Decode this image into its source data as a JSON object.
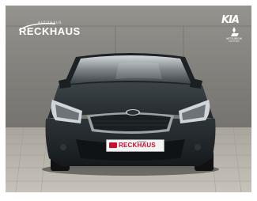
{
  "photo": {
    "subject": "kia-ceed-front-view",
    "colors": {
      "wall": "#8d8b86",
      "wall_dark": "#6f6d68",
      "floor": "#b7b2aa",
      "car_body": "#2a3136",
      "car_dark": "#14181b",
      "grille_chrome": "#9aa3a8",
      "sky_reflection": "#c9ced0"
    }
  },
  "dealer_logo": {
    "prefix": "AUTOHAUS",
    "name": "RECKHAUS"
  },
  "brand_logos": {
    "kia": "KIA",
    "mitsubishi": "MITSUBISHI",
    "mitsubishi_sub": "MOTORS"
  },
  "license_plate": {
    "prefix": "AUTOHAUS",
    "name": "RECKHAUS"
  },
  "bumper_text": "RECKHAUS"
}
